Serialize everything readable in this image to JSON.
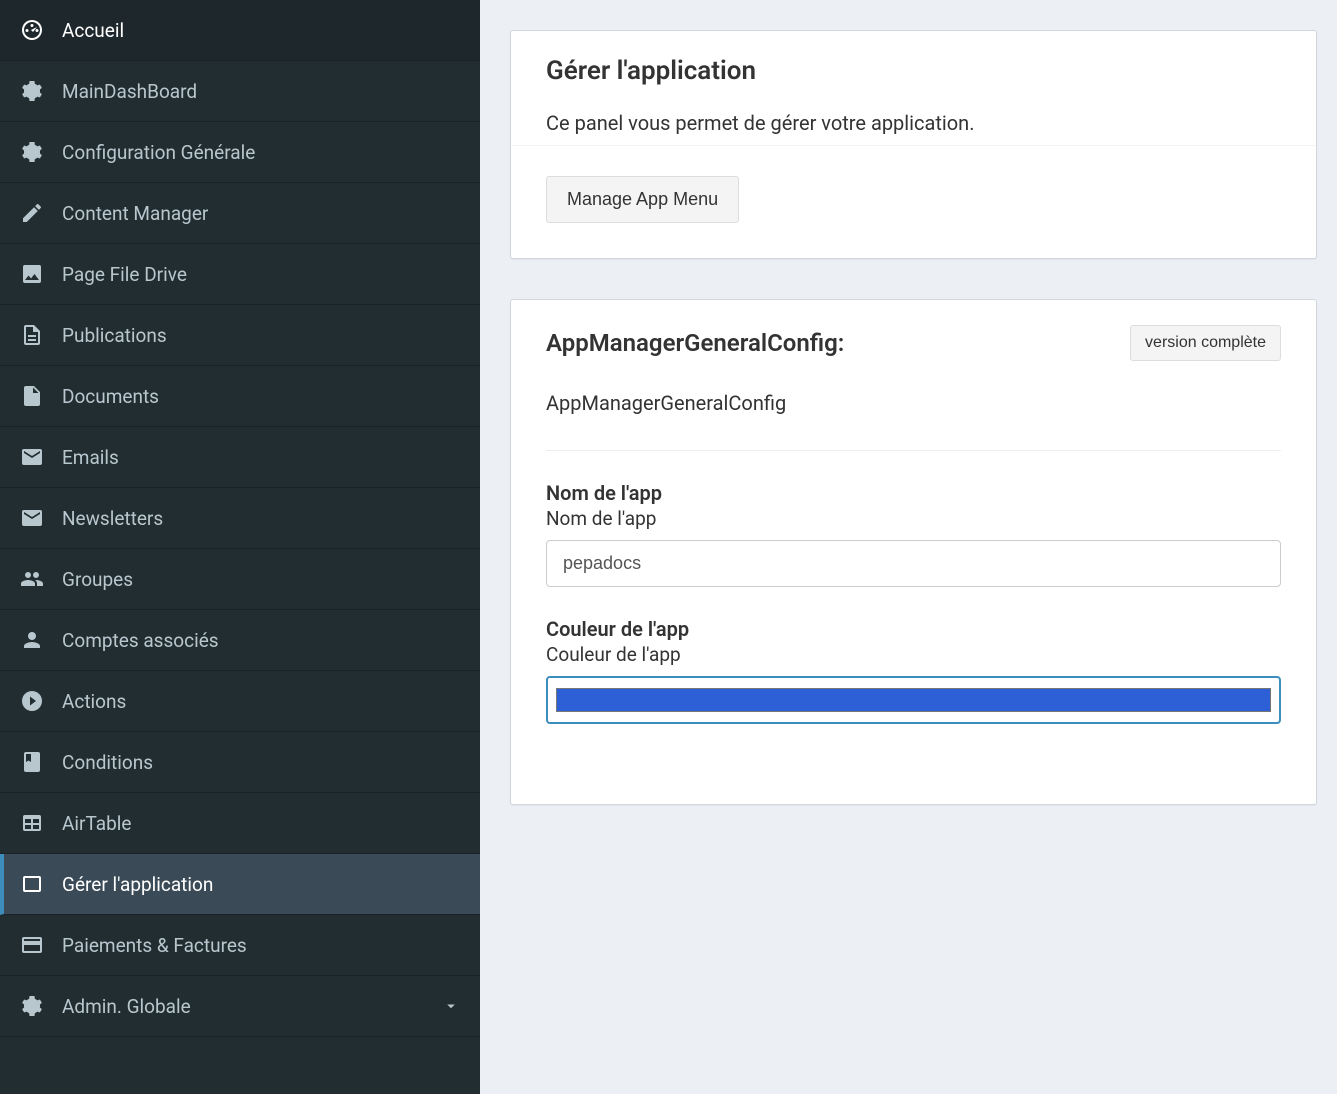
{
  "sidebar": {
    "items": [
      {
        "label": "Accueil",
        "icon": "dashboard"
      },
      {
        "label": "MainDashBoard",
        "icon": "gears"
      },
      {
        "label": "Configuration Générale",
        "icon": "gear"
      },
      {
        "label": "Content Manager",
        "icon": "pencil"
      },
      {
        "label": "Page File Drive",
        "icon": "image"
      },
      {
        "label": "Publications",
        "icon": "file-text"
      },
      {
        "label": "Documents",
        "icon": "file"
      },
      {
        "label": "Emails",
        "icon": "envelope"
      },
      {
        "label": "Newsletters",
        "icon": "envelope"
      },
      {
        "label": "Groupes",
        "icon": "users"
      },
      {
        "label": "Comptes associés",
        "icon": "user"
      },
      {
        "label": "Actions",
        "icon": "play-circle"
      },
      {
        "label": "Conditions",
        "icon": "book"
      },
      {
        "label": "AirTable",
        "icon": "table"
      },
      {
        "label": "Gérer l'application",
        "icon": "tablet",
        "active": true
      },
      {
        "label": "Paiements & Factures",
        "icon": "credit-card"
      },
      {
        "label": "Admin. Globale",
        "icon": "gears",
        "has_children": true
      }
    ]
  },
  "panel1": {
    "title": "Gérer l'application",
    "subtitle": "Ce panel vous permet de gérer votre application.",
    "button": "Manage App Menu"
  },
  "panel2": {
    "title": "AppManagerGeneralConfig:",
    "version_button": "version complète",
    "config_name": "AppManagerGeneralConfig",
    "fields": {
      "app_name": {
        "label_strong": "Nom de l'app",
        "label_sub": "Nom de l'app",
        "value": "pepadocs"
      },
      "app_color": {
        "label_strong": "Couleur de l'app",
        "label_sub": "Couleur de l'app",
        "value": "#2d5fd6"
      }
    }
  }
}
